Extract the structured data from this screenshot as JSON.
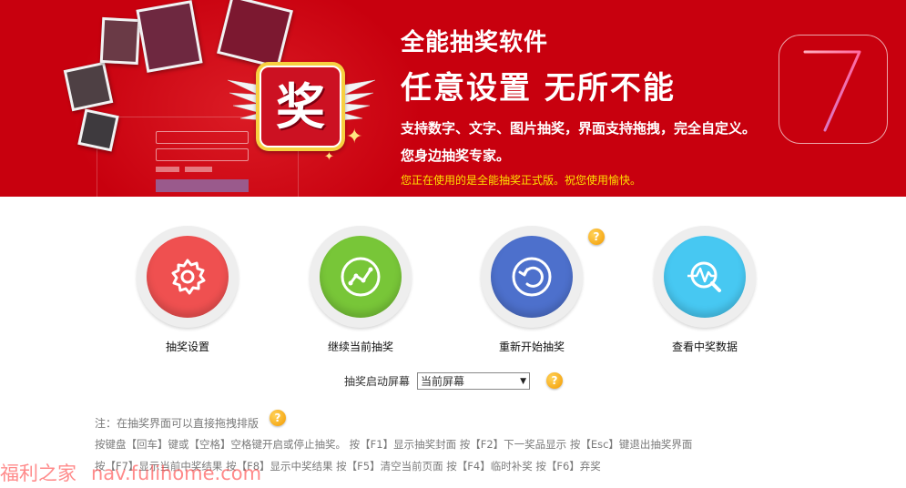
{
  "banner": {
    "title_line1": "全能抽奖软件",
    "title_line2": "任意设置  无所不能",
    "desc_line1": "支持数字、文字、图片抽奖，界面支持拖拽，完全自定义。",
    "desc_line2": "您身边抽奖专家。",
    "status": "您正在使用的是全能抽奖正式版。祝您使用愉快。",
    "award_char": "奖",
    "version_mark": "7",
    "color_bg": "#c8000e",
    "color_status": "#ffe000"
  },
  "actions": [
    {
      "label": "抽奖设置",
      "icon": "gear-icon",
      "color": "#ef5050"
    },
    {
      "label": "继续当前抽奖",
      "icon": "trend-line-icon",
      "color": "#78c638"
    },
    {
      "label": "重新开始抽奖",
      "icon": "restart-icon",
      "color": "#4d70cc"
    },
    {
      "label": "查看中奖数据",
      "icon": "data-search-icon",
      "color": "#47c8f2"
    }
  ],
  "help_icon": "?",
  "screen_select": {
    "label": "抽奖启动屏幕",
    "value": "当前屏幕"
  },
  "notes": {
    "drag_hint": "注：在抽奖界面可以直接拖拽排版",
    "shortcuts_line1": "按键盘【回车】键或【空格】空格键开启或停止抽奖。     按【F1】显示抽奖封面    按【F2】下一奖品显示    按【Esc】键退出抽奖界面",
    "shortcuts_line2": "按【F7】显示当前中奖结果    按【F8】显示中奖结果    按【F5】清空当前页面    按【F4】临时补奖    按【F6】弃奖"
  },
  "watermark": {
    "name": "福利之家",
    "url": "nav.fulihome.com"
  }
}
